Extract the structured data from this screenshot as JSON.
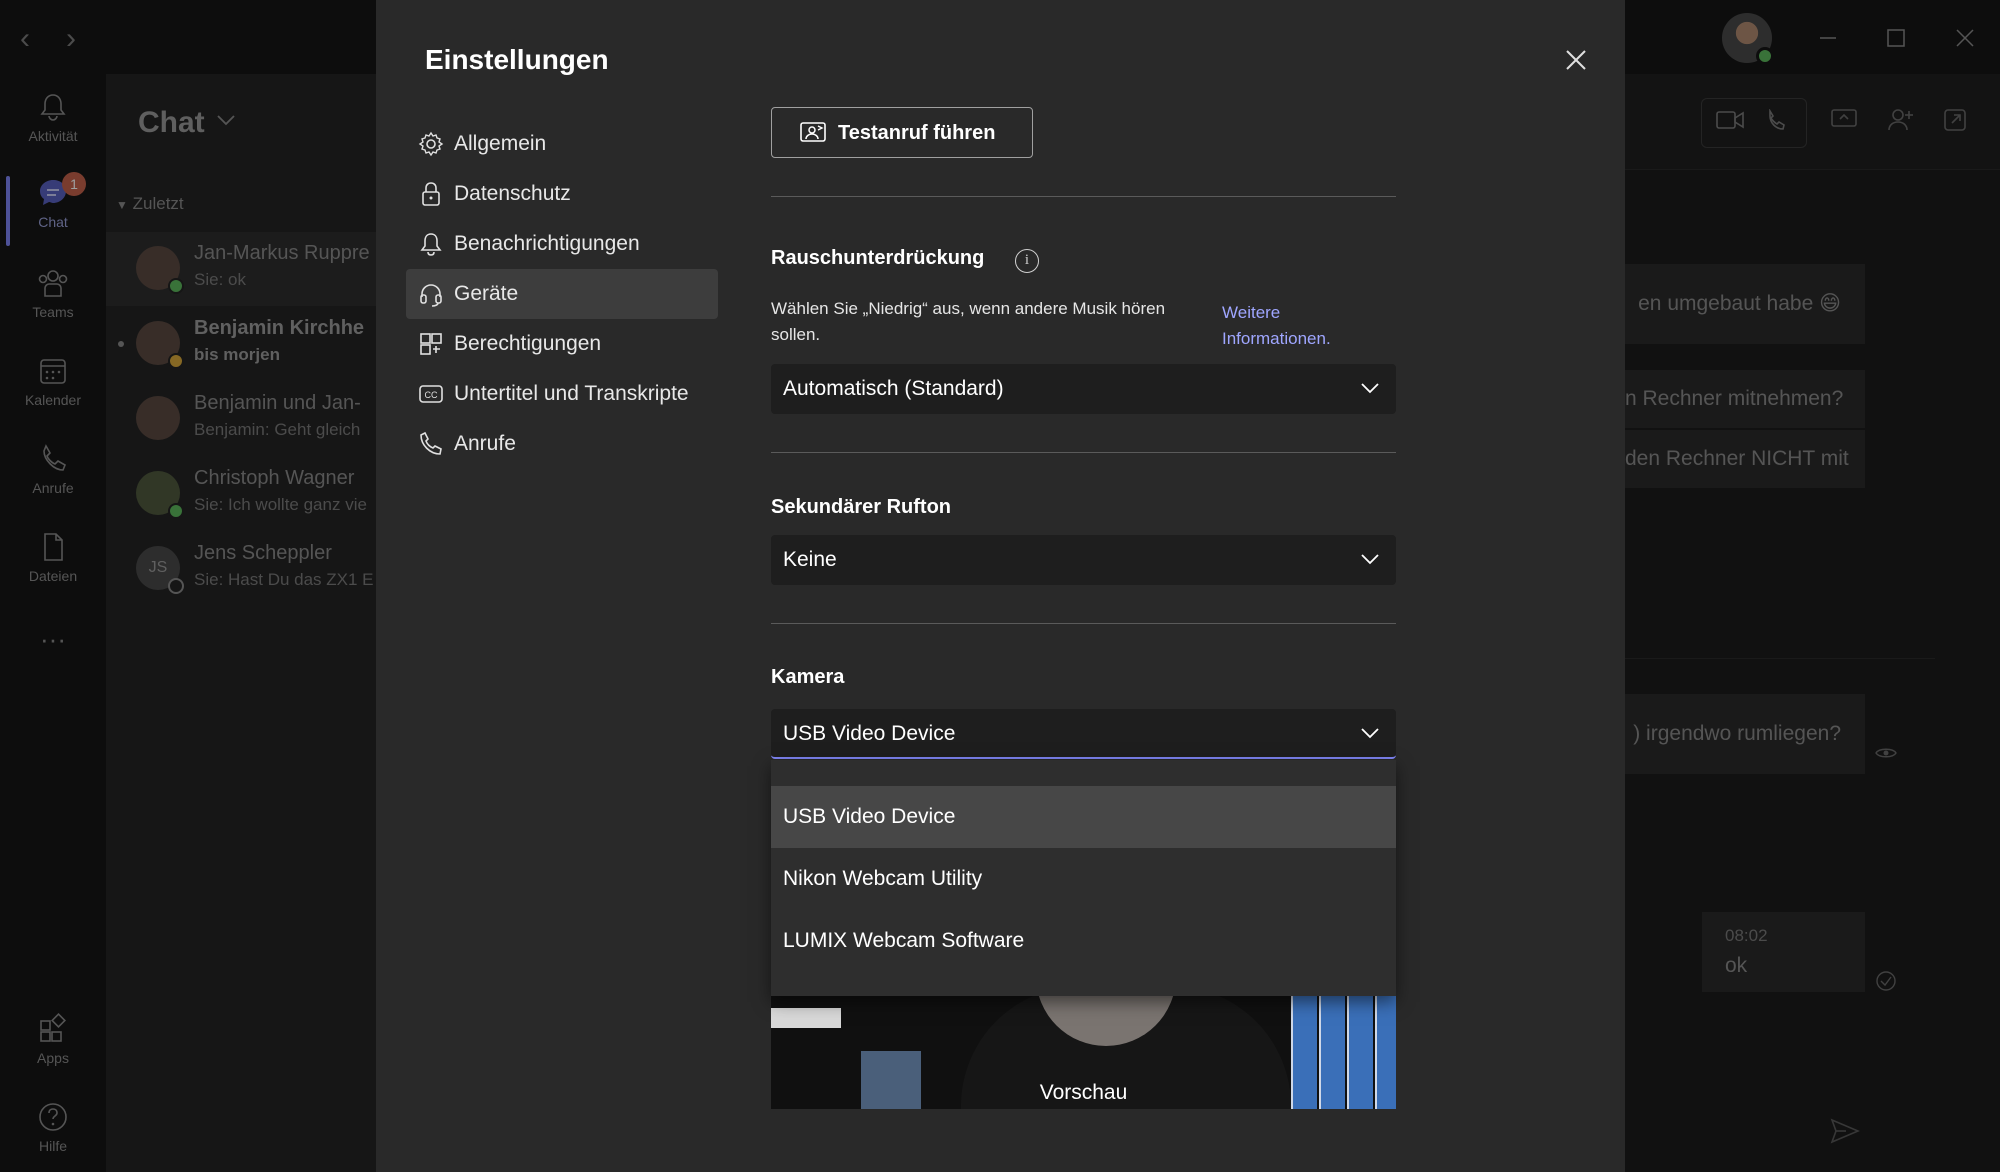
{
  "titlebar": {
    "back": "‹",
    "forward": "›"
  },
  "rail": {
    "items": [
      {
        "label": "Aktivität",
        "icon": "bell-icon"
      },
      {
        "label": "Chat",
        "icon": "chat-icon",
        "badge": "1"
      },
      {
        "label": "Teams",
        "icon": "teams-icon"
      },
      {
        "label": "Kalender",
        "icon": "calendar-icon"
      },
      {
        "label": "Anrufe",
        "icon": "phone-icon"
      },
      {
        "label": "Dateien",
        "icon": "file-icon"
      },
      {
        "label": "···",
        "icon": "more-icon"
      }
    ],
    "apps": "Apps",
    "help": "Hilfe"
  },
  "chatpane": {
    "title": "Chat",
    "section": "Zuletzt",
    "chats": [
      {
        "name": "Jan-Markus Ruppre",
        "sub": "Sie: ok"
      },
      {
        "name": "Benjamin Kirchhe",
        "sub": "bis morjen"
      },
      {
        "name": "Benjamin und Jan-",
        "sub": "Benjamin: Geht gleich"
      },
      {
        "name": "Christoph Wagner",
        "sub": "Sie: Ich wollte ganz vie"
      },
      {
        "name": "Jens Scheppler",
        "sub": "Sie: Hast Du das ZX1 E",
        "initials": "JS"
      }
    ]
  },
  "conversation": {
    "bubbles": [
      "en umgebaut habe 😄",
      "n Rechner mitnehmen?",
      "den Rechner NICHT mit",
      ") irgendwo rumliegen?"
    ],
    "last_time": "08:02",
    "last_text": "ok"
  },
  "settings": {
    "title": "Einstellungen",
    "nav": [
      {
        "label": "Allgemein",
        "icon": "gear-icon"
      },
      {
        "label": "Datenschutz",
        "icon": "lock-icon"
      },
      {
        "label": "Benachrichtigungen",
        "icon": "bell-icon"
      },
      {
        "label": "Geräte",
        "icon": "headset-icon",
        "active": true
      },
      {
        "label": "Berechtigungen",
        "icon": "permissions-icon"
      },
      {
        "label": "Untertitel und Transkripte",
        "icon": "cc-icon"
      },
      {
        "label": "Anrufe",
        "icon": "phone-icon"
      }
    ],
    "test_call_label": "Testanruf führen",
    "noise": {
      "title": "Rauschunterdrückung",
      "info": "i",
      "description": "Wählen Sie „Niedrig“ aus, wenn andere Musik hören sollen.",
      "more_link": "Weitere Informationen.",
      "value": "Automatisch (Standard)"
    },
    "ringer": {
      "title": "Sekundärer Rufton",
      "value": "Keine"
    },
    "camera": {
      "title": "Kamera",
      "value": "USB Video Device",
      "options": [
        "USB Video Device",
        "Nikon Webcam Utility",
        "LUMIX Webcam Software"
      ],
      "preview_label": "Vorschau"
    }
  },
  "colors": {
    "accent": "#7f85f5",
    "link": "#9fa6ff",
    "dialog_bg": "#292929",
    "select_bg": "#1e1e1e"
  }
}
